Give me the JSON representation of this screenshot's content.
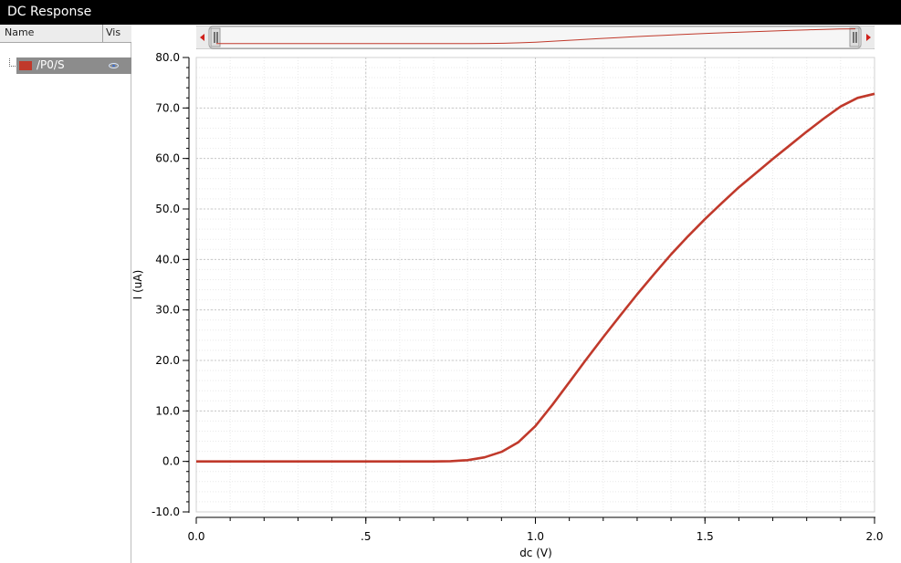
{
  "window": {
    "title": "DC Response"
  },
  "signal_list": {
    "columns": [
      "Name",
      "Vis"
    ],
    "items": [
      {
        "name": "/P0/S",
        "color": "#c0392b",
        "visible": true
      }
    ]
  },
  "chart_data": {
    "type": "line",
    "xlabel": "dc (V)",
    "ylabel": "I (uA)",
    "xlim": [
      0.0,
      2.0
    ],
    "ylim": [
      -10.0,
      80.0
    ],
    "x_ticks": [
      0.0,
      0.5,
      1.0,
      1.5,
      2.0
    ],
    "x_tick_labels": [
      "0.0",
      ".5",
      "1.0",
      "1.5",
      "2.0"
    ],
    "y_ticks": [
      -10,
      0,
      10,
      20,
      30,
      40,
      50,
      60,
      70,
      80
    ],
    "y_tick_labels": [
      "-10.0",
      "0.0",
      "10.0",
      "20.0",
      "30.0",
      "40.0",
      "50.0",
      "60.0",
      "70.0",
      "80.0"
    ],
    "grid": true,
    "series": [
      {
        "name": "/P0/S",
        "color": "#c0392b",
        "x": [
          0.0,
          0.1,
          0.2,
          0.3,
          0.4,
          0.5,
          0.6,
          0.7,
          0.75,
          0.8,
          0.85,
          0.9,
          0.95,
          1.0,
          1.05,
          1.1,
          1.15,
          1.2,
          1.25,
          1.3,
          1.35,
          1.4,
          1.45,
          1.5,
          1.55,
          1.6,
          1.65,
          1.7,
          1.75,
          1.8,
          1.85,
          1.9,
          1.95,
          2.0
        ],
        "y": [
          0.0,
          0.0,
          0.0,
          0.0,
          0.0,
          0.0,
          0.0,
          0.0,
          0.05,
          0.25,
          0.8,
          1.9,
          3.8,
          7.0,
          11.2,
          15.7,
          20.2,
          24.6,
          28.9,
          33.1,
          37.1,
          41.0,
          44.6,
          48.0,
          51.2,
          54.3,
          57.1,
          59.9,
          62.6,
          65.3,
          67.9,
          70.3,
          72.0,
          72.8
        ]
      }
    ]
  }
}
